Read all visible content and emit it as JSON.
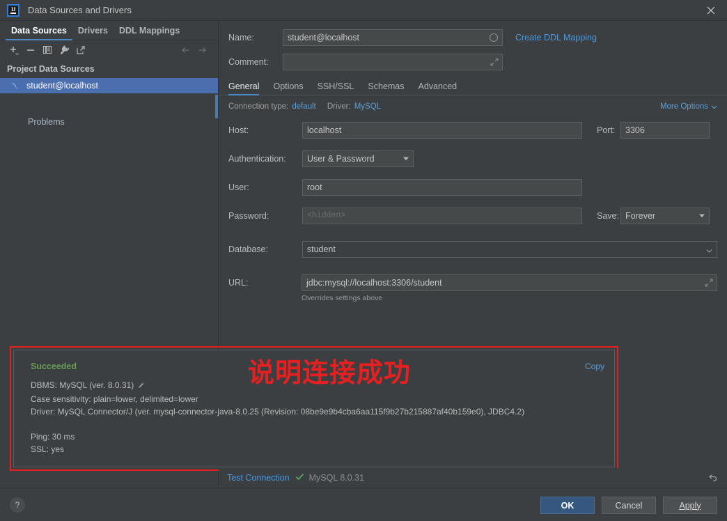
{
  "window": {
    "title": "Data Sources and Drivers",
    "app_icon": "intellij-idea-icon",
    "close_label": "✕"
  },
  "left_panel": {
    "tabs": [
      {
        "label": "Data Sources",
        "active": true
      },
      {
        "label": "Drivers",
        "active": false
      },
      {
        "label": "DDL Mappings",
        "active": false
      }
    ],
    "toolbar_icons": [
      "add-icon",
      "remove-icon",
      "copy-icon",
      "wrench-icon",
      "open-external-icon",
      "back-arrow-icon",
      "forward-arrow-icon"
    ],
    "section_title": "Project Data Sources",
    "data_sources": [
      {
        "label": "student@localhost",
        "icon": "mysql-dolphin-icon",
        "selected": true
      }
    ],
    "problems_label": "Problems"
  },
  "form": {
    "name_label": "Name:",
    "name_value": "student@localhost",
    "name_field_icon": "circle-icon",
    "create_ddl_mapping": "Create DDL Mapping",
    "comment_label": "Comment:",
    "comment_value": "",
    "comment_field_icon": "expand-icon",
    "tabs": [
      {
        "label": "General",
        "active": true
      },
      {
        "label": "Options",
        "active": false
      },
      {
        "label": "SSH/SSL",
        "active": false
      },
      {
        "label": "Schemas",
        "active": false
      },
      {
        "label": "Advanced",
        "active": false
      }
    ],
    "connection_type_label": "Connection type:",
    "connection_type_value": "default",
    "driver_label": "Driver:",
    "driver_value": "MySQL",
    "more_options": "More Options",
    "host_label": "Host:",
    "host_value": "localhost",
    "port_label": "Port:",
    "port_value": "3306",
    "authentication_label": "Authentication:",
    "authentication_value": "User & Password",
    "user_label": "User:",
    "user_value": "root",
    "password_label": "Password:",
    "password_placeholder": "<hidden>",
    "save_label": "Save:",
    "save_value": "Forever",
    "database_label": "Database:",
    "database_value": "student",
    "url_label": "URL:",
    "url_value": "jdbc:mysql://localhost:3306/student",
    "url_field_icon": "expand-icon",
    "url_hint": "Overrides settings above"
  },
  "result": {
    "status": "Succeeded",
    "copy_label": "Copy",
    "annotation": "说明连接成功",
    "lines": [
      "DBMS: MySQL (ver. 8.0.31)",
      "Case sensitivity: plain=lower, delimited=lower",
      "Driver: MySQL Connector/J (ver. mysql-connector-java-8.0.25 (Revision: 08be9e9b4cba6aa115f9b27b215887af40b159e0), JDBC4.2)",
      "",
      "Ping: 30 ms",
      "SSL: yes"
    ],
    "edit_icon": "pencil-icon"
  },
  "test_bar": {
    "test_connection_label": "Test Connection",
    "status_icon": "check-icon",
    "version_label": "MySQL 8.0.31",
    "revert_icon": "revert-icon"
  },
  "footer": {
    "help_label": "?",
    "ok_label": "OK",
    "cancel_label": "Cancel",
    "apply_label": "Apply"
  },
  "colors": {
    "background": "#3c3f41",
    "selection": "#4b6eaf",
    "accent": "#4a88c7",
    "link": "#5c9fd6",
    "success": "#6a9c55",
    "annotation_red": "#e62020",
    "primary_button": "#365880"
  }
}
